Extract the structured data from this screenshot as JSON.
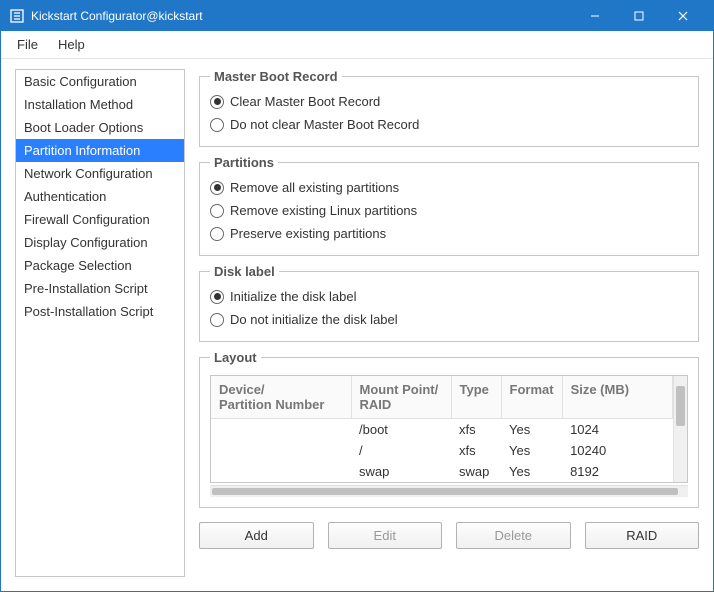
{
  "window": {
    "title": "Kickstart Configurator@kickstart"
  },
  "menubar": {
    "file": "File",
    "help": "Help"
  },
  "sidebar": {
    "items": [
      {
        "label": "Basic Configuration",
        "selected": false
      },
      {
        "label": "Installation Method",
        "selected": false
      },
      {
        "label": "Boot Loader Options",
        "selected": false
      },
      {
        "label": "Partition Information",
        "selected": true
      },
      {
        "label": "Network Configuration",
        "selected": false
      },
      {
        "label": "Authentication",
        "selected": false
      },
      {
        "label": "Firewall Configuration",
        "selected": false
      },
      {
        "label": "Display Configuration",
        "selected": false
      },
      {
        "label": "Package Selection",
        "selected": false
      },
      {
        "label": "Pre-Installation Script",
        "selected": false
      },
      {
        "label": "Post-Installation Script",
        "selected": false
      }
    ]
  },
  "groups": {
    "mbr": {
      "legend": "Master Boot Record",
      "options": [
        {
          "label": "Clear Master Boot Record",
          "checked": true
        },
        {
          "label": "Do not clear Master Boot Record",
          "checked": false
        }
      ]
    },
    "partitions": {
      "legend": "Partitions",
      "options": [
        {
          "label": "Remove all existing partitions",
          "checked": true
        },
        {
          "label": "Remove existing Linux partitions",
          "checked": false
        },
        {
          "label": "Preserve existing partitions",
          "checked": false
        }
      ]
    },
    "disklabel": {
      "legend": "Disk label",
      "options": [
        {
          "label": "Initialize the disk label",
          "checked": true
        },
        {
          "label": "Do not initialize the disk label",
          "checked": false
        }
      ]
    },
    "layout": {
      "legend": "Layout",
      "headers": {
        "device": "Device/\nPartition Number",
        "mount": "Mount Point/\nRAID",
        "type": "Type",
        "format": "Format",
        "size": "Size (MB)"
      },
      "rows": [
        {
          "device": "",
          "mount": "/boot",
          "type": "xfs",
          "format": "Yes",
          "size": "1024"
        },
        {
          "device": "",
          "mount": "/",
          "type": "xfs",
          "format": "Yes",
          "size": "10240"
        },
        {
          "device": "",
          "mount": "swap",
          "type": "swap",
          "format": "Yes",
          "size": "8192"
        }
      ]
    }
  },
  "buttons": {
    "add": "Add",
    "edit": "Edit",
    "delete": "Delete",
    "raid": "RAID"
  }
}
